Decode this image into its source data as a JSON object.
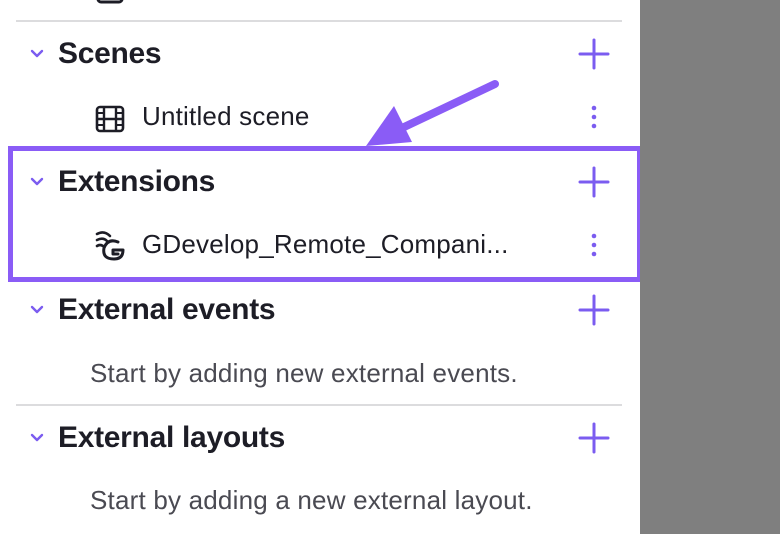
{
  "colors": {
    "accent": "#7b5cf0",
    "highlight": "#8a5cf6",
    "arrow": "#8a5cf6",
    "backdrop": "#7f7f7f",
    "divider": "#dcdcde",
    "text": "#1d1d26",
    "muted_text": "#4a4a52"
  },
  "sections": [
    {
      "title": "Scenes",
      "icons": {
        "chevron": "chevron-down-icon",
        "add": "plus-icon"
      },
      "items": [
        {
          "label": "Untitled scene",
          "icon": "film-icon",
          "menu_icon": "more-vertical-icon"
        }
      ]
    },
    {
      "title": "Extensions",
      "icons": {
        "chevron": "chevron-down-icon",
        "add": "plus-icon"
      },
      "items": [
        {
          "label": "GDevelop_Remote_Compani...",
          "icon": "extension-logo-icon",
          "menu_icon": "more-vertical-icon"
        }
      ]
    },
    {
      "title": "External events",
      "icons": {
        "chevron": "chevron-down-icon",
        "add": "plus-icon"
      },
      "empty_text": "Start by adding new external events."
    },
    {
      "title": "External layouts",
      "icons": {
        "chevron": "chevron-down-icon",
        "add": "plus-icon"
      },
      "empty_text": "Start by adding a new external layout."
    }
  ]
}
